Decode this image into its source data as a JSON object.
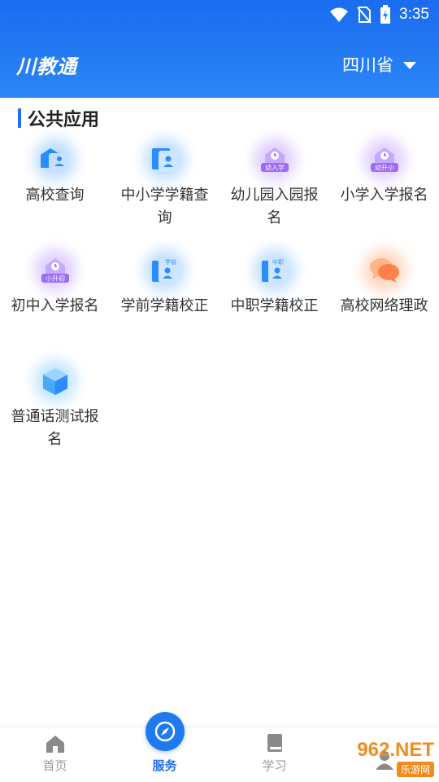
{
  "status": {
    "time": "3:35"
  },
  "header": {
    "logo": "川教通",
    "province": "四川省"
  },
  "section": {
    "title": "公共应用"
  },
  "apps": [
    {
      "label": "高校查询",
      "icon": "university-query-icon"
    },
    {
      "label": "中小学学籍查询",
      "icon": "student-record-query-icon"
    },
    {
      "label": "幼儿园入园报名",
      "icon": "kindergarten-enroll-icon",
      "badge": "幼入学"
    },
    {
      "label": "小学入学报名",
      "icon": "primary-enroll-icon",
      "badge": "幼升小"
    },
    {
      "label": "初中入学报名",
      "icon": "junior-enroll-icon",
      "badge": "小升初"
    },
    {
      "label": "学前学籍校正",
      "icon": "preschool-record-correct-icon",
      "badge": "学前"
    },
    {
      "label": "中职学籍校正",
      "icon": "vocational-record-correct-icon",
      "badge": "中职"
    },
    {
      "label": "高校网络理政",
      "icon": "university-online-gov-icon"
    },
    {
      "label": "普通话测试报名",
      "icon": "mandarin-test-icon"
    }
  ],
  "tabs": [
    {
      "label": "首页",
      "icon": "home-icon"
    },
    {
      "label": "服务",
      "icon": "compass-icon"
    },
    {
      "label": "学习",
      "icon": "book-icon"
    },
    {
      "label": "",
      "icon": "user-icon"
    }
  ],
  "watermark": {
    "top": "962.NET",
    "bottom": "乐游网"
  },
  "colors": {
    "primary": "#1f6ff0",
    "header": "#2c86f5"
  }
}
